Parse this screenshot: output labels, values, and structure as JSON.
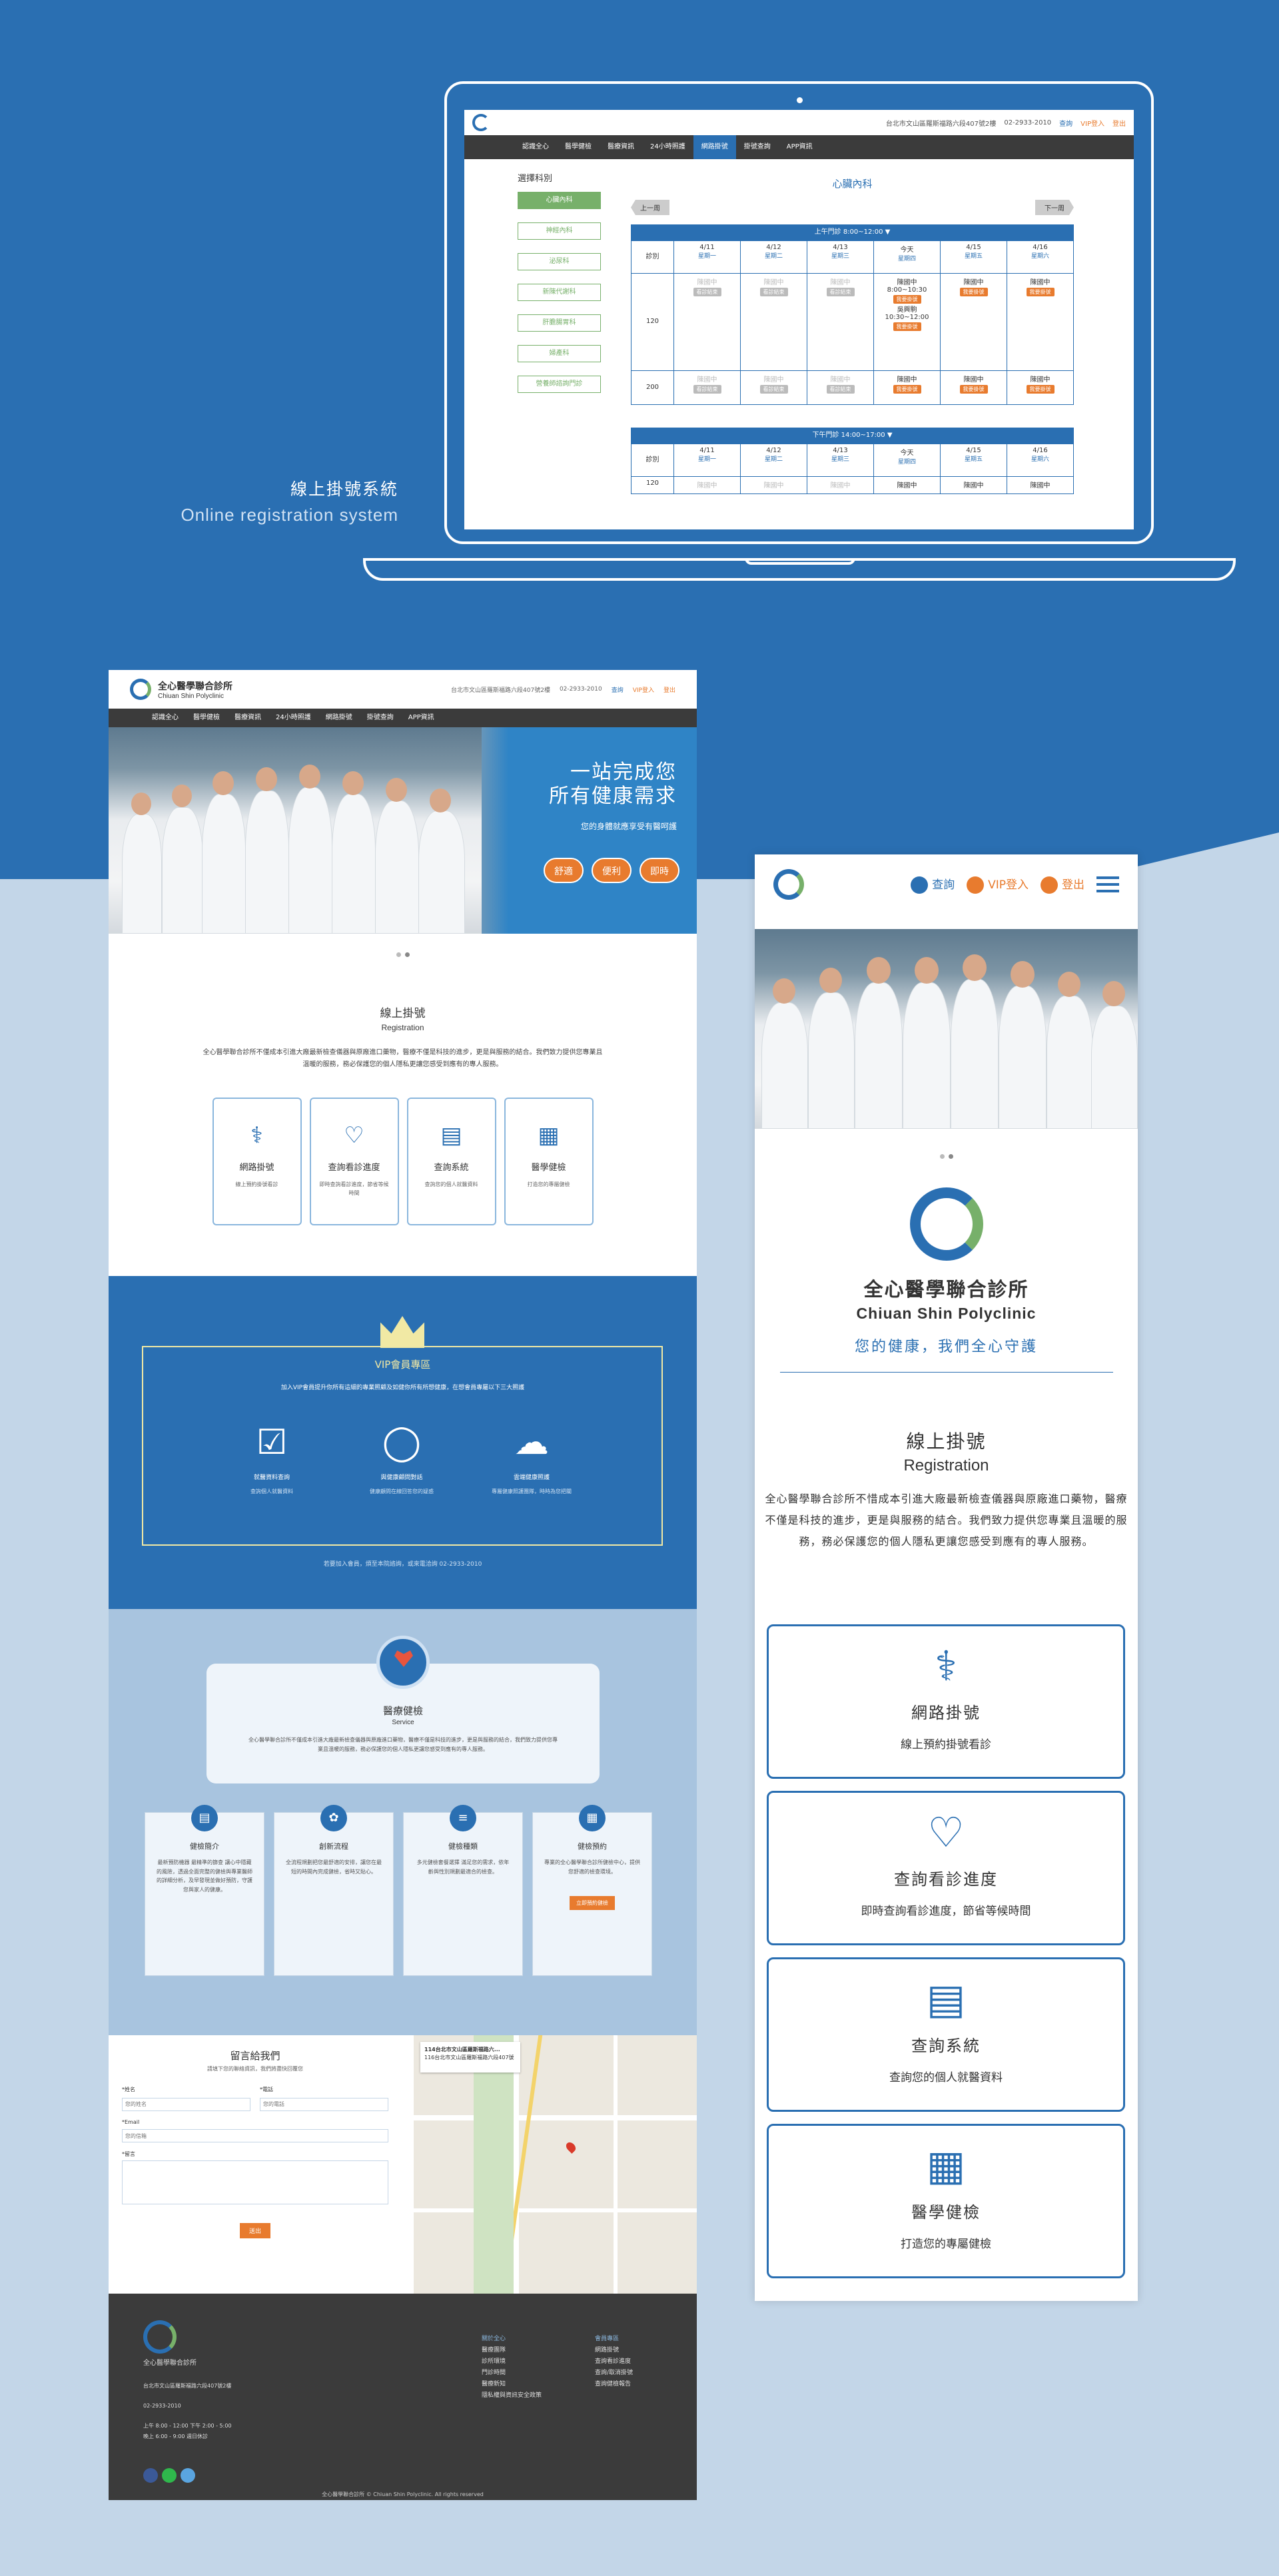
{
  "section": {
    "title": "線上掛號系統",
    "subtitle": "Online registration system"
  },
  "laptop": {
    "address": "台北市文山區羅斯福路六段407號2樓",
    "phone": "02-2933-2010",
    "actions": [
      "查詢",
      "VIP登入",
      "登出"
    ],
    "nav": [
      "認識全心",
      "醫學健檢",
      "醫療資訊",
      "24小時照護",
      "網路掛號",
      "掛號查詢",
      "APP資訊"
    ],
    "sidebar_title": "選擇科別",
    "departments": [
      "心臟內科",
      "神經內科",
      "泌尿科",
      "新陳代謝科",
      "肝膽腸胃科",
      "婦產科",
      "營養師諮詢門診"
    ],
    "main_title": "心臟內科",
    "prev": "上一周",
    "next": "下一周",
    "morning_bar": "上午門診 8:00~12:00 ▼",
    "afternoon_bar": "下午門診 14:00~17:00 ▼",
    "clinic_label": "診別",
    "days": [
      {
        "date": "4/11",
        "week": "星期一"
      },
      {
        "date": "4/12",
        "week": "星期二"
      },
      {
        "date": "4/13",
        "week": "星期三"
      },
      {
        "date": "今天",
        "week": "星期四"
      },
      {
        "date": "4/15",
        "week": "星期五"
      },
      {
        "date": "4/16",
        "week": "星期六"
      }
    ],
    "room1": "120",
    "room2": "200",
    "doctor": "陳國中",
    "doctor2": "吳興駒",
    "time1": "8:00~10:30",
    "time2": "10:30~12:00",
    "book": "我要掛號",
    "full": "看診結束"
  },
  "desktop": {
    "clinic_name": "全心醫學聯合診所",
    "clinic_en": "Chiuan Shin Polyclinic",
    "address": "台北市文山區羅斯福路六段407號2樓",
    "phone": "02-2933-2010",
    "actions": [
      "查詢",
      "VIP登入",
      "登出"
    ],
    "nav": [
      "認識全心",
      "醫學健檢",
      "醫療資訊",
      "24小時照護",
      "網路掛號",
      "掛號查詢",
      "APP資訊"
    ],
    "hero_title_1": "一站完成您",
    "hero_title_2": "所有健康需求",
    "hero_sub": "您的身體就應享受有醫呵護",
    "hero_tags": [
      "舒適",
      "便利",
      "即時"
    ],
    "reg_title": "線上掛號",
    "reg_sub": "Registration",
    "reg_desc": "全心醫學聯合診所不僅成本引進大廠最新檢查儀器與原廠進口藥物，醫療不僅是科技的進步，更是與服務的結合。我們致力提供您專業且溫暖的服務，務必保護您的個人隱私更讓您感受到應有的專人服務。",
    "cards": [
      {
        "name": "網路掛號",
        "desc": "線上預約掛號看診"
      },
      {
        "name": "查詢看診進度",
        "desc": "即時查詢看診進度，節省等候時間"
      },
      {
        "name": "查詢系統",
        "desc": "查詢您的個人就醫資料"
      },
      {
        "name": "醫學健檢",
        "desc": "打造您的專屬健檢"
      }
    ],
    "vip_title": "VIP會員專區",
    "vip_desc": "加入VIP會員提升你所有這細的專業照顧及如健你所有所想健康，在想會員專屬以下三大照護",
    "vip_items": [
      {
        "a": "就醫資料查詢",
        "b": "查詢個人就醫資料"
      },
      {
        "a": "與健康顧問對話",
        "b": "健康顧問在線回答您的疑惑"
      },
      {
        "a": "雲端健康照護",
        "b": "專屬健康照護團隊，時時為您把關"
      }
    ],
    "vip_footer": "若要加入會員，煩至本院諮詢，或來電洽詢 02-2933-2010",
    "svc_title": "醫療健檢",
    "svc_sub": "Service",
    "svc_desc": "全心醫學聯合診所不僅成本引進大廠最新檢查儀器與原廠進口藥物，醫療不僅是科技的進步，更是與服務的結合，我們致力提供您專業且溫暖的服務，務必保護您的個人隱私更讓您感受到應有的專人服務。",
    "svc_cards": [
      {
        "name": "健檢簡介",
        "desc": "最新預防機器 最精準的篩查 讓心中隱藏的風險，透過全面完整的健檢與專業醫師的詳細分析，及早發現並做好預防，守護您與家人的健康。"
      },
      {
        "name": "創新流程",
        "desc": "全流程規劃把您最舒適的安排，讓您在最短的時間內完成健檢，省時又貼心。"
      },
      {
        "name": "健檢種類",
        "desc": "多元健檢套餐選擇 滿足您的需求，依年齡與性別規劃最適合的檢查。"
      },
      {
        "name": "健檢預約",
        "desc": "專業的全心醫學聯合診所健檢中心，提供您舒適的檢查環境。",
        "btn": "立即預約健檢"
      }
    ],
    "contact_title": "留言給我們",
    "contact_sub": "請填下您的聯絡資訊，我們將盡快回覆您",
    "f_name": "*姓名",
    "f_phone": "*電話",
    "f_email": "*Email",
    "f_msg": "*留言",
    "f_name_ph": "您的姓名",
    "f_phone_ph": "您的電話",
    "f_email_ph": "您的信箱",
    "send": "送出",
    "map_title": "114台北市文山區羅斯福路六...",
    "map_addr": "116台北市文山區羅斯福路六段407號",
    "footer_name": "全心醫學聯合診所",
    "footer_address": "台北市文山區羅斯福路六段407號2樓",
    "footer_phone": "02-2933-2010",
    "footer_hours": "上午 8:00 - 12:00  下午 2:00 - 5:00",
    "footer_hours2": "晚上 6:00 - 9:00  週日休診",
    "footer_col1_title": "關於全心",
    "footer_col1": [
      "醫療團隊",
      "診所環境",
      "門診時間",
      "醫療新知",
      "隱私權與資訊安全政策"
    ],
    "footer_col2_title": "會員專區",
    "footer_col2": [
      "網路掛號",
      "查詢看診進度",
      "查詢/取消掛號",
      "查詢健檢報告"
    ],
    "copyright": "全心醫學聯合診所 © Chiuan Shin Polyclinic. All rights reserved"
  },
  "mobile": {
    "actions": [
      "查詢",
      "VIP登入",
      "登出"
    ],
    "name": "全心醫學聯合診所",
    "name_en": "Chiuan Shin Polyclinic",
    "slogan": "您的健康，我們全心守護",
    "reg_title": "線上掛號",
    "reg_sub": "Registration",
    "reg_desc": "全心醫學聯合診所不惜成本引進大廠最新檢查儀器與原廠進口藥物，醫療不僅是科技的進步，更是與服務的結合。我們致力提供您專業且溫暖的服務，務必保護您的個人隱私更讓您感受到應有的專人服務。",
    "cards": [
      {
        "name": "網路掛號",
        "desc": "線上預約掛號看診"
      },
      {
        "name": "查詢看診進度",
        "desc": "即時查詢看診進度，節省等候時間"
      },
      {
        "name": "查詢系統",
        "desc": "查詢您的個人就醫資料"
      },
      {
        "name": "醫學健檢",
        "desc": "打造您的專屬健檢"
      }
    ]
  },
  "colors": {
    "primary": "#2a6fb2",
    "accent": "#e87b2e",
    "green": "#77b06a",
    "gold": "#f1e9a4"
  }
}
